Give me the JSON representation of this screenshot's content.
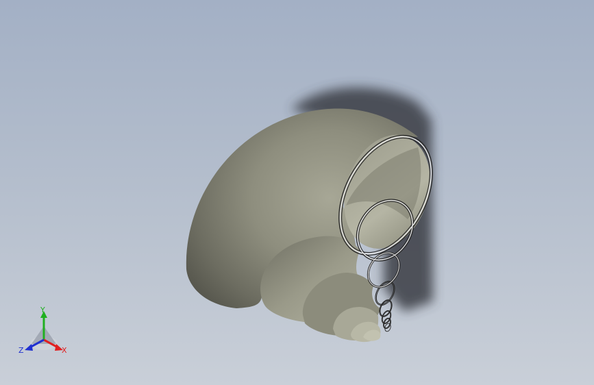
{
  "viewport": {
    "background_top": "#a3b0c5",
    "background_bottom": "#c9cfd8"
  },
  "model": {
    "surface_color": "#8f8f7f",
    "shadow_color": "#3a3d44",
    "edge_color": "#2a2a2a"
  },
  "triad": {
    "x_label": "X",
    "y_label": "Y",
    "z_label": "Z",
    "x_color": "#e02020",
    "y_color": "#20b020",
    "z_color": "#2030d0"
  }
}
